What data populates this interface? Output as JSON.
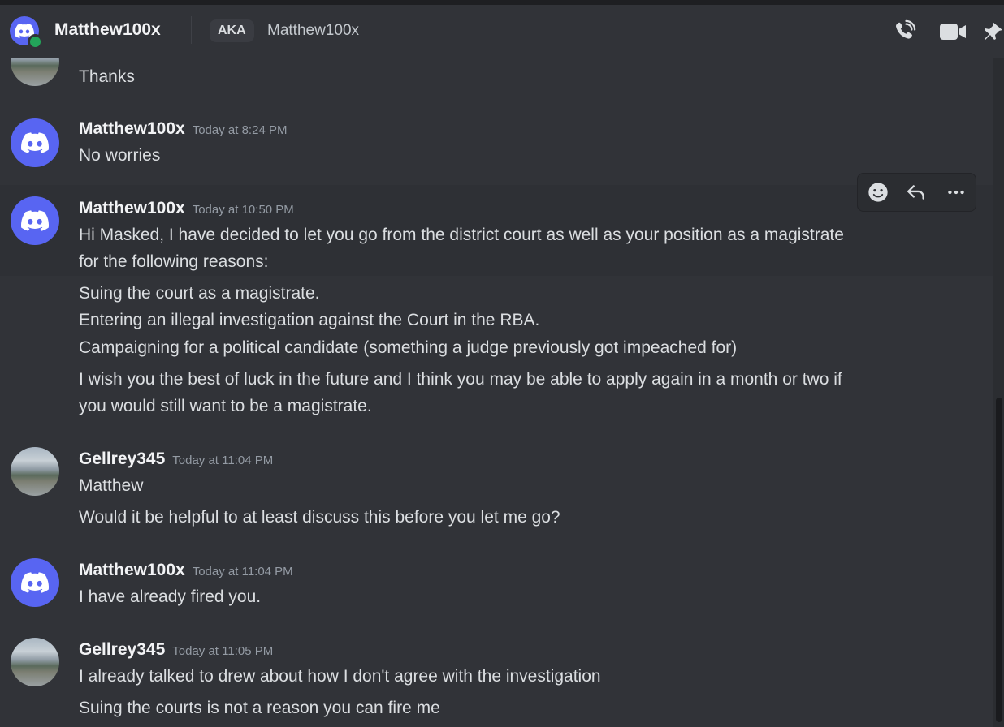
{
  "header": {
    "username": "Matthew100x",
    "aka_label": "AKA",
    "aka_name": "Matthew100x",
    "icons": [
      "discord-logo-icon",
      "phone-call-icon",
      "video-camera-icon",
      "pin-icon"
    ],
    "status_color": "#23a55a"
  },
  "messages": [
    {
      "lines": [
        "Thanks"
      ],
      "avatar": "photo"
    },
    {
      "author": "Matthew100x",
      "timestamp": "Today at 8:24 PM",
      "avatar": "discord",
      "lines": [
        "No worries"
      ]
    },
    {
      "author": "Matthew100x",
      "timestamp": "Today at 10:50 PM",
      "avatar": "discord",
      "lines": [
        "Hi Masked, I have decided to let you go from the district court as well as your position as a magistrate",
        "for the following reasons:",
        "Suing the court as a magistrate.",
        "Entering an illegal investigation against the Court in the RBA.",
        "Campaigning for a political candidate (something a judge previously got impeached for)",
        "I wish you the best of luck in the future and I think you may be able to apply again in a month or two if",
        "you would still want to be a magistrate."
      ]
    },
    {
      "author": "Gellrey345",
      "timestamp": "Today at 11:04 PM",
      "avatar": "photo",
      "lines": [
        "Matthew",
        "Would it be helpful to at least discuss this before you let me go?"
      ]
    },
    {
      "author": "Matthew100x",
      "timestamp": "Today at 11:04 PM",
      "avatar": "discord",
      "lines": [
        "I have already fired you."
      ]
    },
    {
      "author": "Gellrey345",
      "timestamp": "Today at 11:05 PM",
      "avatar": "photo",
      "lines": [
        "I already talked to drew about how I don't agree with the investigation",
        "Suing the courts is not a reason you can fire me"
      ]
    }
  ],
  "toolbar": {
    "icons": [
      "add-reaction-icon",
      "reply-icon",
      "more-options-icon"
    ]
  },
  "colors": {
    "background": "#313338",
    "accent": "#5865f2",
    "timestamp": "#949ba4"
  }
}
